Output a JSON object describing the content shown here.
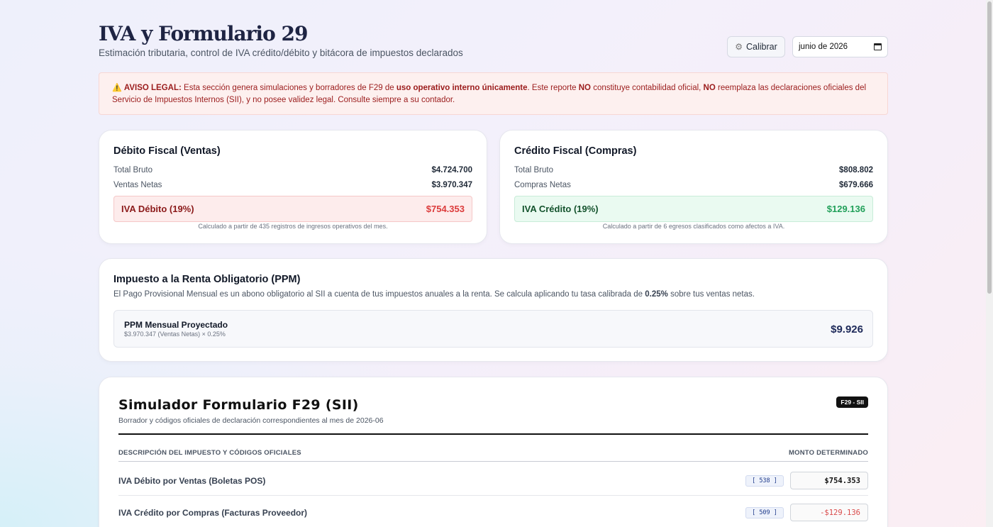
{
  "header": {
    "title": "IVA y Formulario 29",
    "subtitle": "Estimación tributaria, control de IVA crédito/débito y bitácora de impuestos declarados",
    "calibrate_label": "Calibrar",
    "month_value": "junio de 2026"
  },
  "legal": {
    "label": "AVISO LEGAL:",
    "t1": " Esta sección genera simulaciones y borradores de F29 de ",
    "b1": "uso operativo interno únicamente",
    "t2": ". Este reporte ",
    "b2": "NO",
    "t3": " constituye contabilidad oficial, ",
    "b3": "NO",
    "t4": " reemplaza las declaraciones oficiales del Servicio de Impuestos Internos (SII), y no posee validez legal. Consulte siempre a su contador."
  },
  "debit": {
    "title": "Débito Fiscal (Ventas)",
    "gross_label": "Total Bruto",
    "gross_value": "$4.724.700",
    "net_label": "Ventas Netas",
    "net_value": "$3.970.347",
    "iva_label": "IVA Débito (19%)",
    "iva_value": "$754.353",
    "note": "Calculado a partir de 435 registros de ingresos operativos del mes."
  },
  "credit": {
    "title": "Crédito Fiscal (Compras)",
    "gross_label": "Total Bruto",
    "gross_value": "$808.802",
    "net_label": "Compras Netas",
    "net_value": "$679.666",
    "iva_label": "IVA Crédito (19%)",
    "iva_value": "$129.136",
    "note": "Calculado a partir de 6 egresos clasificados como afectos a IVA."
  },
  "ppm": {
    "title": "Impuesto a la Renta Obligatorio (PPM)",
    "desc_pre": "El Pago Provisional Mensual es un abono obligatorio al SII a cuenta de tus impuestos anuales a la renta. Se calcula aplicando tu tasa calibrada de ",
    "desc_rate": "0.25%",
    "desc_post": " sobre tus ventas netas.",
    "box_label": "PPM Mensual Proyectado",
    "formula": "$3.970.347 (Ventas Netas) × 0.25%",
    "amount": "$9.926"
  },
  "f29": {
    "title": "Simulador Formulario F29 (SII)",
    "subtitle": "Borrador y códigos oficiales de declaración correspondientes al mes de 2026-06",
    "badge": "F29 - SII",
    "col_desc": "DESCRIPCIÓN DEL IMPUESTO Y CÓDIGOS OFICIALES",
    "col_amount": "MONTO DETERMINADO",
    "rows": [
      {
        "desc": "IVA Débito por Ventas (Boletas POS)",
        "code": "[ 538 ]",
        "amount": "$754.353"
      },
      {
        "desc": "IVA Crédito por Compras (Facturas Proveedor)",
        "code": "[ 509 ]",
        "amount": "-$129.136"
      }
    ]
  }
}
